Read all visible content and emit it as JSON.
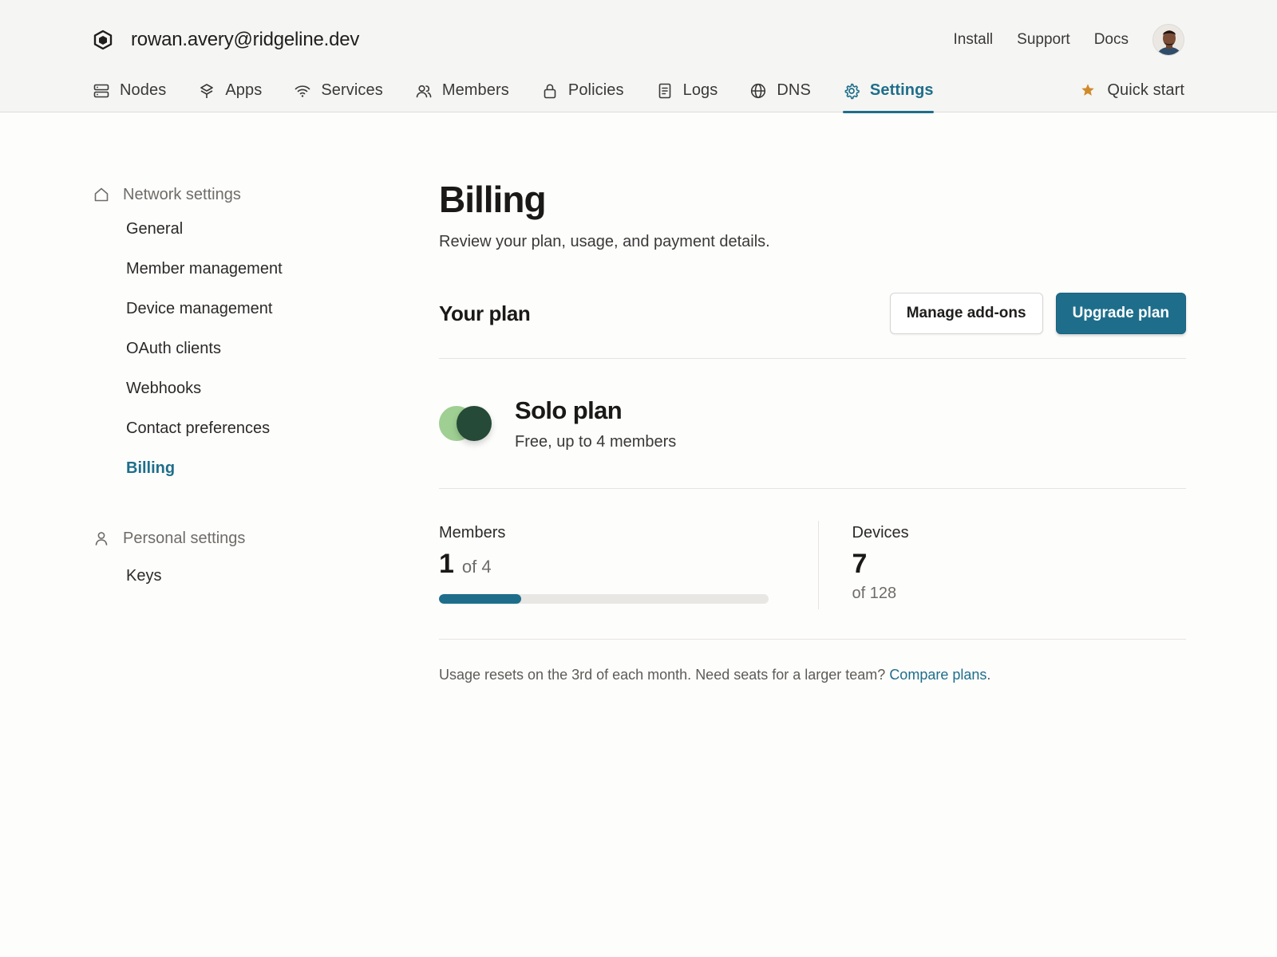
{
  "header": {
    "account_email": "rowan.avery@ridgeline.dev",
    "top_links": [
      "Install",
      "Support",
      "Docs"
    ],
    "nav": [
      {
        "label": "Nodes",
        "icon": "server-icon"
      },
      {
        "label": "Apps",
        "icon": "apps-icon"
      },
      {
        "label": "Services",
        "icon": "wifi-icon"
      },
      {
        "label": "Members",
        "icon": "users-icon"
      },
      {
        "label": "Policies",
        "icon": "lock-icon"
      },
      {
        "label": "Logs",
        "icon": "document-icon"
      },
      {
        "label": "DNS",
        "icon": "globe-icon"
      },
      {
        "label": "Settings",
        "icon": "gear-icon",
        "active": true
      }
    ],
    "quick_start": "Quick start"
  },
  "sidebar": {
    "network_section": "Network settings",
    "network_items": [
      "General",
      "Member management",
      "Device management",
      "OAuth clients",
      "Webhooks",
      "Contact preferences",
      "Billing"
    ],
    "active_item": "Billing",
    "personal_section": "Personal settings",
    "personal_items": [
      "Keys"
    ]
  },
  "main": {
    "title": "Billing",
    "subtitle": "Review your plan, usage, and payment details.",
    "plan_section_title": "Your plan",
    "manage_addons_label": "Manage add-ons",
    "upgrade_label": "Upgrade plan",
    "plan": {
      "name": "Solo plan",
      "description": "Free, up to 4 members"
    },
    "members": {
      "label": "Members",
      "value": "1",
      "limit_text": "of 4",
      "progress": 0.25
    },
    "devices": {
      "label": "Devices",
      "value": "7",
      "limit_text": "of 128"
    },
    "footnote_text": "Usage resets on the 3rd of each month. Need seats for a larger team? ",
    "footnote_link": "Compare plans",
    "footnote_end": "."
  },
  "colors": {
    "accent": "#1e6e8b",
    "plan_light": "#9fcf93",
    "plan_dark": "#254a38",
    "star": "#d08a2a"
  }
}
